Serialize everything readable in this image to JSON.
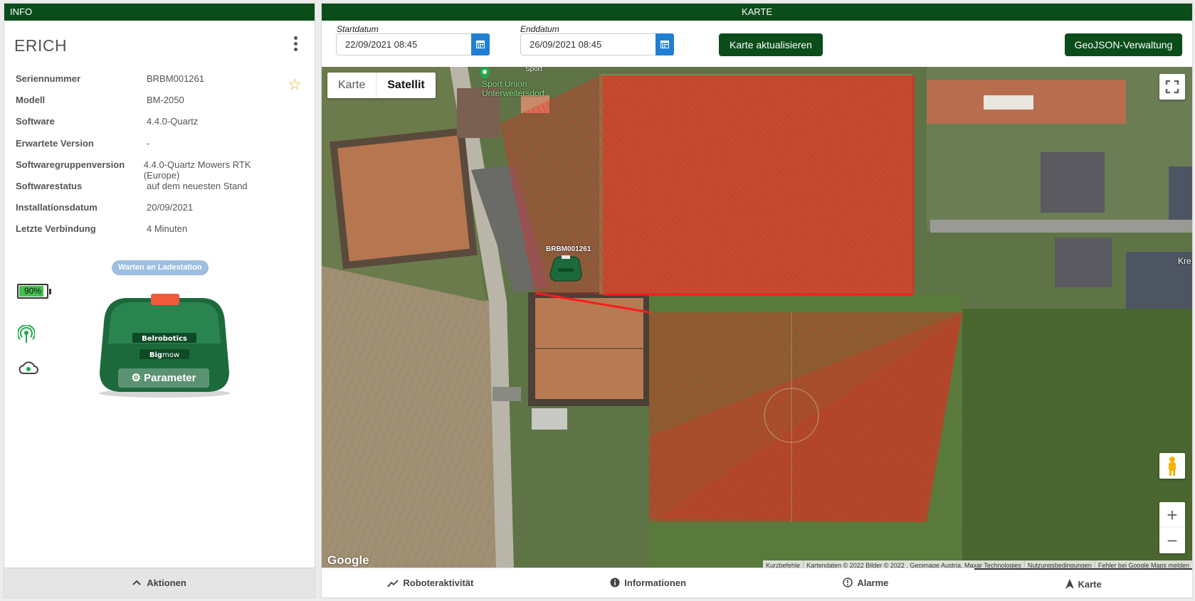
{
  "info": {
    "header": "INFO",
    "name": "ERICH",
    "details": [
      {
        "key": "Seriennummer",
        "value": "BRBM001261"
      },
      {
        "key": "Modell",
        "value": "BM-2050"
      },
      {
        "key": "Software",
        "value": "4.4.0-Quartz"
      },
      {
        "key": "Erwartete Version",
        "value": "-"
      },
      {
        "key": "Softwaregruppenversion",
        "value": "4.4.0-Quartz Mowers RTK (Europe)"
      },
      {
        "key": "Softwarestatus",
        "value": "auf dem neuesten Stand"
      },
      {
        "key": "Installationsdatum",
        "value": "20/09/2021"
      },
      {
        "key": "Letzte Verbindung",
        "value": "4 Minuten"
      }
    ],
    "status": "Warten an Ladestation",
    "battery_label": "90%",
    "battery_level": 0.9,
    "parameter_button": "Parameter",
    "mower_brand": "Belrobotics",
    "mower_model_bold": "Big",
    "mower_model_light": "mow",
    "actions_label": "Aktionen",
    "colors": {
      "header": "#0b4d1a",
      "star": "#e8b725",
      "status_pill": "#9dbfe0",
      "battery_fill": "#43c04e",
      "signal": "#1ea84a"
    }
  },
  "map_panel": {
    "header": "KARTE",
    "start_label": "Startdatum",
    "start_value": "22/09/2021 08:45",
    "end_label": "Enddatum",
    "end_value": "26/09/2021 08:45",
    "refresh_button": "Karte aktualisieren",
    "geojson_button": "GeoJSON-Verwaltung",
    "map_type_karte": "Karte",
    "map_type_satellit": "Satellit",
    "selected_map_type": "Satellit",
    "mower_marker_label": "BRBM001261",
    "place_name_line1": "Sport Union",
    "place_name_line2": "Unterweitersdorf",
    "place_top_label": "Sport",
    "street_label": "Kre",
    "google_logo": "Google",
    "attribution": [
      "Kurzbefehle",
      "Kartendaten © 2022 Bilder © 2022 , Geoimage Austria, Maxar Technologies",
      "Nutzungsbedingungen",
      "Fehler bei Google Maps melden"
    ],
    "path_color": "#ff1a1a",
    "tabs": [
      {
        "label": "Roboteraktivität",
        "icon": "activity-chart-icon"
      },
      {
        "label": "Informationen",
        "icon": "info-icon"
      },
      {
        "label": "Alarme",
        "icon": "alert-icon"
      },
      {
        "label": "Karte",
        "icon": "navigation-arrow-icon"
      }
    ],
    "active_tab": "Karte"
  }
}
